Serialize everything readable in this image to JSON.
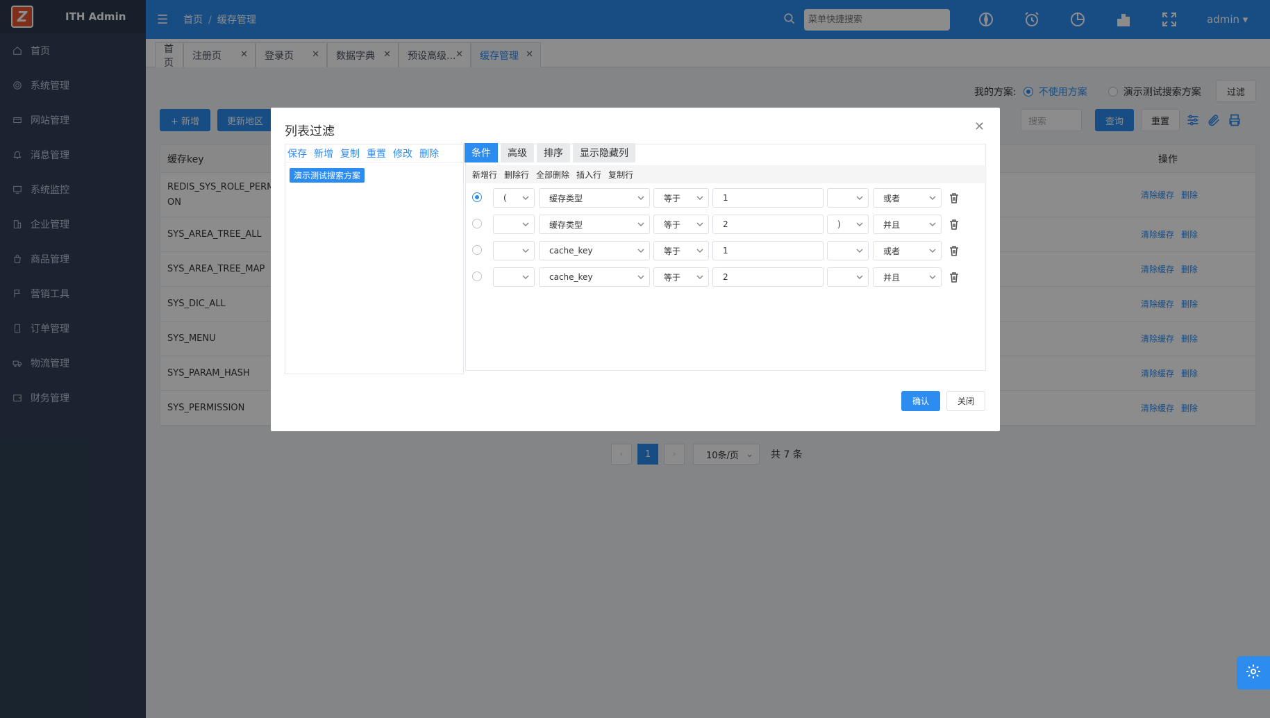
{
  "app": {
    "logo_text": "ITH Admin"
  },
  "sidebar": {
    "items": [
      {
        "label": "首页",
        "icon": "home-icon"
      },
      {
        "label": "系统管理",
        "icon": "gear-icon"
      },
      {
        "label": "网站管理",
        "icon": "card-icon"
      },
      {
        "label": "消息管理",
        "icon": "bell-icon"
      },
      {
        "label": "系统监控",
        "icon": "monitor-icon"
      },
      {
        "label": "企业管理",
        "icon": "building-icon"
      },
      {
        "label": "商品管理",
        "icon": "bag-icon"
      },
      {
        "label": "营销工具",
        "icon": "flag-icon"
      },
      {
        "label": "订单管理",
        "icon": "phone-icon"
      },
      {
        "label": "物流管理",
        "icon": "truck-icon"
      },
      {
        "label": "财务管理",
        "icon": "wallet-icon"
      }
    ]
  },
  "header": {
    "breadcrumb": [
      "首页",
      "缓存管理"
    ],
    "search_placeholder": "菜单快捷搜索",
    "user": "admin"
  },
  "tabs": [
    {
      "label": "首页",
      "closable": false
    },
    {
      "label": "注册页",
      "closable": true
    },
    {
      "label": "登录页",
      "closable": true
    },
    {
      "label": "数据字典",
      "closable": true
    },
    {
      "label": "预设高级...",
      "closable": true
    },
    {
      "label": "缓存管理",
      "closable": true,
      "active": true
    }
  ],
  "toolbar": {
    "scheme_label": "我的方案:",
    "scheme_options": [
      "不使用方案",
      "演示测试搜索方案"
    ],
    "filter_button": "过滤",
    "add_button": "+ 新增",
    "update_area_button": "更新地区",
    "search_placeholder": "搜索",
    "query_button": "查询",
    "reset_button": "重置"
  },
  "table": {
    "columns": [
      "缓存key",
      "操作"
    ],
    "rows": [
      {
        "key": "REDIS_SYS_ROLE_PERMISSION",
        "key_display": "REDIS_SYS_ROLE_PERM\nON"
      },
      {
        "key": "SYS_AREA_TREE_ALL"
      },
      {
        "key": "SYS_AREA_TREE_MAP"
      },
      {
        "key": "SYS_DIC_ALL"
      },
      {
        "key": "SYS_MENU"
      },
      {
        "key": "SYS_PARAM_HASH"
      },
      {
        "key": "SYS_PERMISSION"
      }
    ],
    "row_actions": [
      "清除缓存",
      "删除"
    ]
  },
  "pagination": {
    "current": "1",
    "page_size": "10条/页",
    "total": "共 7 条"
  },
  "dialog": {
    "title": "列表过滤",
    "scheme_actions": [
      "保存",
      "新增",
      "复制",
      "重置",
      "修改",
      "删除"
    ],
    "scheme_selected": "演示测试搜索方案",
    "tabs": [
      "条件",
      "高级",
      "排序",
      "显示隐藏列"
    ],
    "row_actions": [
      "新增行",
      "删除行",
      "全部删除",
      "插入行",
      "复制行"
    ],
    "conditions": [
      {
        "selected": true,
        "lparen": "(",
        "field": "缓存类型",
        "op": "等于",
        "value": "1",
        "rparen": "",
        "logic": "或者"
      },
      {
        "selected": false,
        "lparen": "",
        "field": "缓存类型",
        "op": "等于",
        "value": "2",
        "rparen": ")",
        "logic": "并且"
      },
      {
        "selected": false,
        "lparen": "",
        "field": "cache_key",
        "op": "等于",
        "value": "1",
        "rparen": "",
        "logic": "或者"
      },
      {
        "selected": false,
        "lparen": "",
        "field": "cache_key",
        "op": "等于",
        "value": "2",
        "rparen": "",
        "logic": "并且"
      }
    ],
    "confirm": "确认",
    "close": "关闭"
  },
  "colors": {
    "primary": "#2d8cf0",
    "sidebar_bg": "#304156",
    "mask": "rgba(0,0,0,0.45)"
  }
}
